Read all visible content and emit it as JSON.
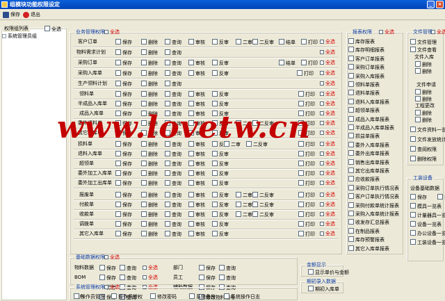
{
  "window": {
    "title": "组模块功能权限设定"
  },
  "toolbar": {
    "save": "保存",
    "exit": "退出"
  },
  "group_panel": {
    "title": "权限组列表",
    "select_all": "全选",
    "items": [
      "系统管理员组"
    ]
  },
  "business": {
    "title": "业务管理权限",
    "select_all": "全选"
  },
  "basic": {
    "title": "基础数据权限",
    "select_all": "全选"
  },
  "system": {
    "title": "系统管理权限",
    "select_all": "全选",
    "items": [
      "操作员管理",
      "操作员授权",
      "修改密码",
      "系统备份",
      "系统操作日志"
    ]
  },
  "report": {
    "title": "报表权限",
    "select_all": "全选",
    "items": [
      "库存报表",
      "库存明细报表",
      "客户订单报表",
      "采购订单报表",
      "采购入库报表",
      "领料单报表",
      "退料单报表",
      "退料入库单报表",
      "超领单报表",
      "成品入库单报表",
      "半成品入库单报表",
      "损益单报表",
      "委外入库单报表",
      "委外出库单报表",
      "销售出库单报表",
      "其它出库单报表",
      "应收款报表",
      "采购订单执行情况表",
      "客户订单执行情况表",
      "采购付款单统计报表",
      "采购入库单统计报表",
      "收发存汇总报表",
      "在制品报表",
      "库存预警报表",
      "其它入库单报表"
    ]
  },
  "file": {
    "title": "文件管理",
    "select_all": "全选",
    "items": [
      "文件管理",
      "文件查看",
      "文件入库",
      "删除",
      "删除",
      "文件申请",
      "删除",
      "删除",
      "工程更改",
      "删除",
      "删除",
      "文件资料一览",
      "文件发放统计",
      "查阅权限",
      "删除权限"
    ]
  },
  "amount": {
    "title": "金额显示",
    "item": "显示单价与金额"
  },
  "stocktake": {
    "title": "期初录入数据",
    "item": "期初入库单"
  },
  "equipment": {
    "title": "工装设备",
    "group_label": "设备基础数据",
    "items": [
      "保存",
      "查",
      "模具一览表",
      "计量器具一览",
      "设备一览表",
      "办公设备一览",
      "工装设备一览"
    ]
  },
  "watermark": "www.lovetw.cn"
}
